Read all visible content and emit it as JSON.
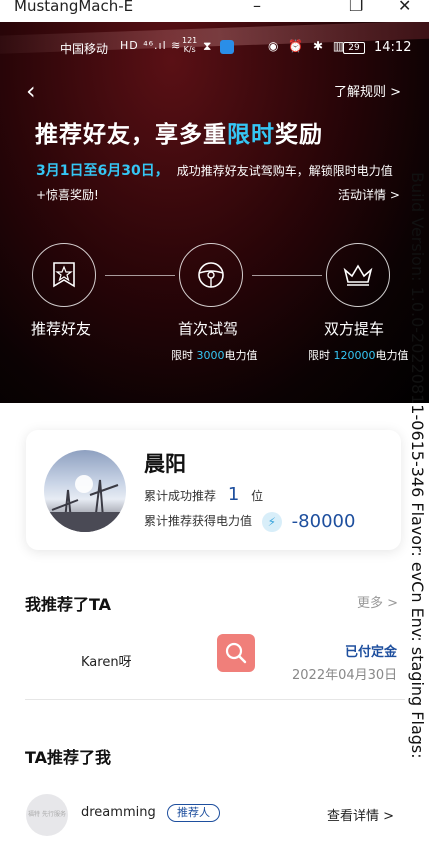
{
  "window": {
    "title": "MustangMach-E",
    "minimize": "–",
    "restore": "❐",
    "close": "✕"
  },
  "status_bar": {
    "carrier": "中国移动",
    "signal": "HD ⁴⁶.ıl ≋",
    "speed_value": "121",
    "speed_unit": "K/s",
    "icons": "◉ ⏰ ✱ ▥",
    "battery": "29",
    "time": "14:12"
  },
  "header": {
    "back_glyph": "‹",
    "rules_link": "了解规则 >",
    "headline_pre": "推荐好友，享多重",
    "headline_highlight": "限时",
    "headline_post": "奖励",
    "date_range": "3月1日至6月30日，",
    "subtitle": "成功推荐好友试驾购车，解锁限时电力值",
    "subtitle2": "+惊喜奖励!",
    "details_link": "活动详情 >"
  },
  "steps": [
    {
      "label": "推荐好友",
      "icon": "star-badge-icon"
    },
    {
      "label": "首次试驾",
      "icon": "steering-wheel-icon",
      "reward_prefix": "限时",
      "reward_value": "3000",
      "reward_suffix": "电力值"
    },
    {
      "label": "双方提车",
      "icon": "crown-icon",
      "reward_prefix": "限时",
      "reward_value": "120000",
      "reward_suffix": "电力值"
    }
  ],
  "watermark": "Build Version: 1.0.0-20220811-0615-346 Flavor: evCn Env: staging Flags:",
  "profile": {
    "name": "晨阳",
    "referrals_label": "累计成功推荐",
    "referrals_count": "1",
    "referrals_unit": "位",
    "power_label": "累计推荐获得电力值",
    "power_value": "-80000"
  },
  "my_referrals": {
    "title": "我推荐了TA",
    "more": "更多 >",
    "items": [
      {
        "name": "Karen呀",
        "status": "已付定金",
        "date": "2022年04月30日"
      }
    ]
  },
  "referred_me": {
    "title": "TA推荐了我",
    "avatar_text": "福特 先行服务",
    "name": "dreamming",
    "tag": "推荐人",
    "action": "查看详情 >"
  },
  "colors": {
    "accent": "#35c6f4",
    "brand_blue": "#1e4f9e",
    "search_button": "#f07f7a"
  }
}
